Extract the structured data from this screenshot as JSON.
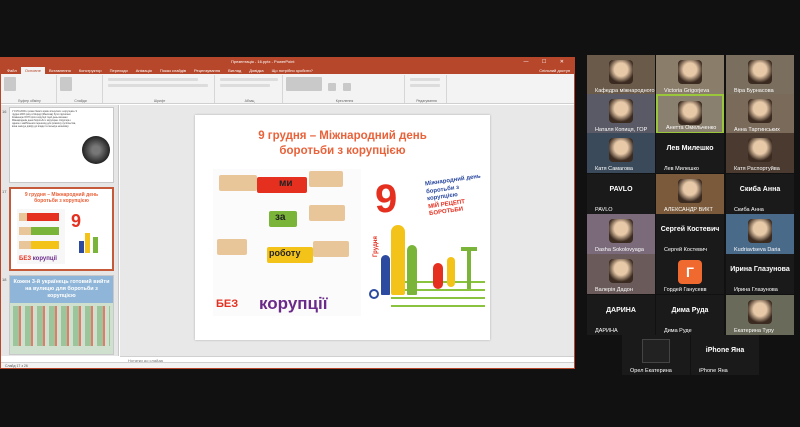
{
  "ppt": {
    "title": "Презентація - 16.pptx - PowerPoint",
    "tabs": [
      "Файл",
      "Основне",
      "Вставлення",
      "Конструктор",
      "Переходи",
      "Анімація",
      "Показ слайдів",
      "Рецензування",
      "Вигляд",
      "Довідка",
      "Що потрібно зробити?"
    ],
    "share": "Спільний доступ",
    "ribbon_groups": [
      "Буфер обміну",
      "Слайди",
      "Шрифт",
      "Абзац",
      "Креслення",
      "Редагування"
    ],
    "notes_placeholder": "Нотатки до слайда",
    "status_left": "Слайд 17 з 26",
    "thumb_numbers": [
      "16",
      "17",
      "18"
    ],
    "thumb1_text": "У 1970-2000-х роках багато країн зіткнулися з корупцією. 9 грудня 2003 року в Мериді (Мексика) було підписано Конвенцію ООН проти корупції. Цей день визнано Міжнародним днем боротьби з корупцією. Корупція є однією з найбільших перешкод для розвитку суспільства, вона знищує довіру до влади та гальмує економіку.",
    "thumb2_title": "9 грудня – Міжнародний день боротьби з корупцією",
    "thumb3_text": "Кожен 3-й українець готовий вийти на вулицю для боротьби з корупцією"
  },
  "slide": {
    "title_line1": "9 грудня – Міжнародний день",
    "title_line2": "боротьби з корупцією",
    "word_mi": "ми",
    "word_za": "за",
    "word_robotu": "роботу",
    "word_bez": "БЕЗ",
    "word_koruptsii": "корупції",
    "big_number": "9",
    "grudnya": "Грудня",
    "right_line1": "Міжнародний день",
    "right_line2": "боротьби з корупцією",
    "right_line3": "МІЙ РЕЦЕПТ БОРОТЬБИ"
  },
  "participants": [
    {
      "name": "Кафедра міжнародного",
      "muted": true
    },
    {
      "name": "Victoria Grigorjeva",
      "muted": true
    },
    {
      "name": "Віра Бурнасова",
      "muted": true
    },
    {
      "name": "Наталя Копиця, ГОР",
      "muted": true
    },
    {
      "name": "Анетта Омельченко",
      "muted": true
    },
    {
      "name": "Анна Тартинських",
      "muted": true
    },
    {
      "name": "Катя Самагова",
      "muted": true
    },
    {
      "name": "Лев Милешко",
      "muted": true,
      "label": "Лев Милешко"
    },
    {
      "name": "Катя Распортуйва",
      "muted": true
    },
    {
      "name": "PAVLO",
      "muted": true,
      "label": "PAVLO"
    },
    {
      "name": "АЛЕКСАНДР ВИКТ",
      "muted": true
    },
    {
      "name": "Скиба Анна",
      "muted": true,
      "label": "Скиба Анна"
    },
    {
      "name": "Dasha Sokolovyaga",
      "muted": true
    },
    {
      "name": "Сергей Костевич",
      "muted": true,
      "label": "Сергей Костевич"
    },
    {
      "name": "Kudriavtseva Daria",
      "muted": true
    },
    {
      "name": "Валерія Дадон",
      "muted": true
    },
    {
      "name": "Гордей Ганусевв",
      "muted": true,
      "label": "Г"
    },
    {
      "name": "Ирина Глазунова",
      "muted": true,
      "label": "Ирина Глазунова"
    },
    {
      "name": "ДАРИНА",
      "muted": true,
      "label": "ДАРИНА"
    },
    {
      "name": "Дима Руде",
      "muted": true,
      "label": "Дима Руда"
    },
    {
      "name": "Екатерина Туру",
      "muted": true
    },
    {
      "name": "Орел Екатерина",
      "muted": true
    },
    {
      "name": "iPhone Яна",
      "muted": true,
      "label": "iPhone Яна"
    }
  ]
}
